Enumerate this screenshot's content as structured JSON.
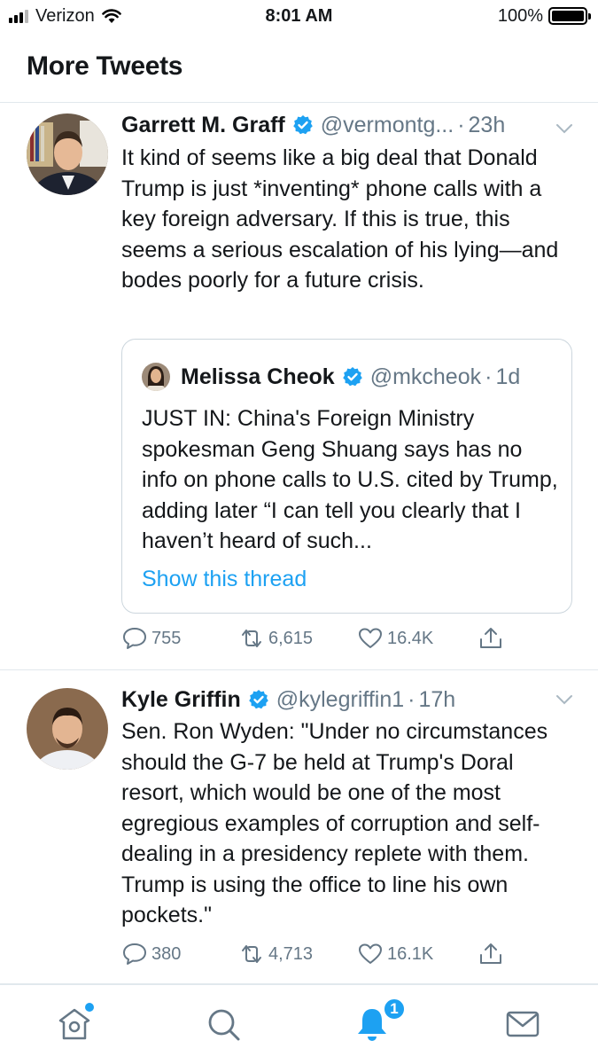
{
  "status_bar": {
    "carrier": "Verizon",
    "time": "8:01 AM",
    "battery": "100%"
  },
  "header": {
    "title": "More Tweets"
  },
  "tweets": [
    {
      "name": "Garrett M. Graff",
      "handle": "@vermontg...",
      "dot": "·",
      "time": "23h",
      "body": "It kind of seems like a big deal that Donald Trump is just *inventing* phone calls with a key foreign adversary. If this is true, this seems a serious escalation of his lying—and bodes poorly for a future crisis.",
      "quote": {
        "name": "Melissa Cheok",
        "handle": "@mkcheok",
        "dot": "·",
        "time": "1d",
        "body": "JUST IN: China's Foreign Ministry spokesman Geng Shuang says has no info on phone calls to U.S. cited by Trump, adding later “I can tell you clearly that I haven’t heard of such...",
        "link": "Show this thread"
      },
      "replies": "755",
      "retweets": "6,615",
      "likes": "16.4K"
    },
    {
      "name": "Kyle Griffin",
      "handle": "@kylegriffin1",
      "dot": "·",
      "time": "17h",
      "body": "Sen. Ron Wyden: \"Under no circumstances should the G-7 be held at Trump's Doral resort, which would be one of the most egregious examples of corruption and self-dealing in a presidency replete with them. Trump is using the office to line his own pockets.\"",
      "replies": "380",
      "retweets": "4,713",
      "likes": "16.1K"
    }
  ],
  "tab_bar": {
    "notifications_badge": "1"
  },
  "colors": {
    "accent": "#1da1f2",
    "secondary_text": "#657786",
    "divider": "#e1e8ed"
  }
}
